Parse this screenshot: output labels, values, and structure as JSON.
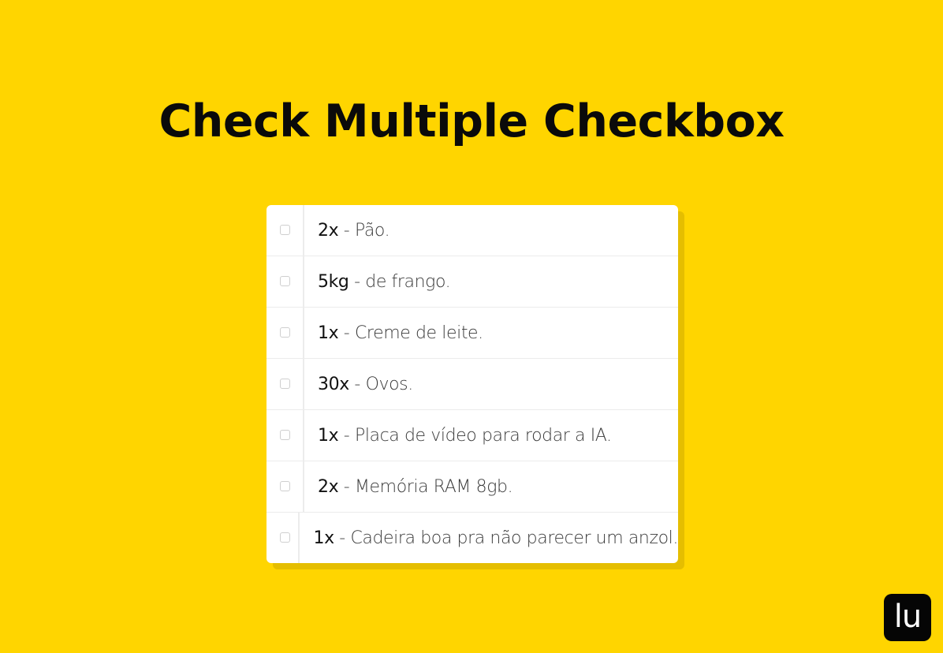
{
  "page": {
    "title": "Check Multiple Checkbox"
  },
  "colors": {
    "background": "#FFD500",
    "card": "#FFFFFF",
    "logo_bg": "#050505"
  },
  "items": [
    {
      "qty": "2x",
      "separator": " - ",
      "desc": "Pão.",
      "checked": false
    },
    {
      "qty": "5kg",
      "separator": " - ",
      "desc": "de frango.",
      "checked": false
    },
    {
      "qty": "1x",
      "separator": " - ",
      "desc": "Creme de leite.",
      "checked": false
    },
    {
      "qty": "30x",
      "separator": " - ",
      "desc": "Ovos.",
      "checked": false
    },
    {
      "qty": "1x",
      "separator": " - ",
      "desc": "Placa de vídeo para rodar a IA.",
      "checked": false
    },
    {
      "qty": "2x",
      "separator": " - ",
      "desc": "Memória RAM 8gb.",
      "checked": false
    },
    {
      "qty": "1x",
      "separator": " - ",
      "desc": "Cadeira boa pra não parecer um anzol.",
      "checked": false
    }
  ],
  "logo": {
    "text": "lu"
  }
}
